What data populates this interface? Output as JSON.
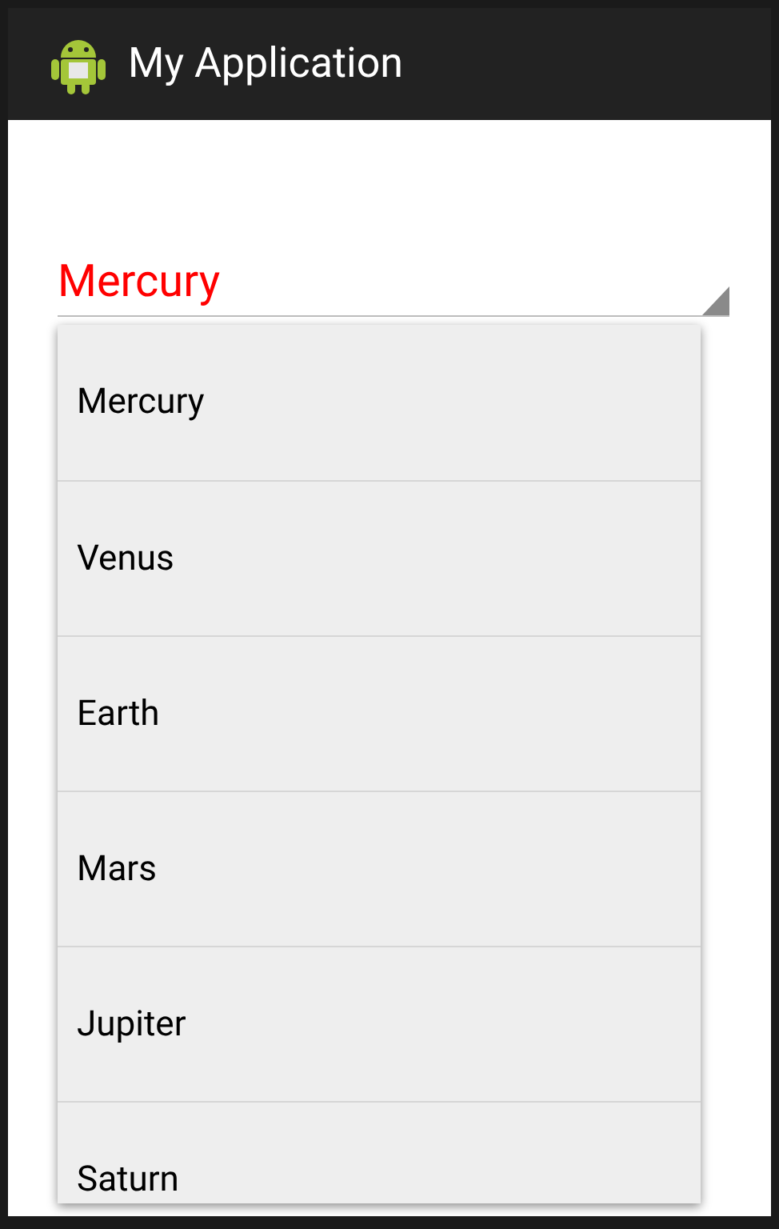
{
  "action_bar": {
    "title": "My Application"
  },
  "spinner": {
    "value": "Mercury"
  },
  "dropdown": {
    "items": [
      {
        "label": "Mercury"
      },
      {
        "label": "Venus"
      },
      {
        "label": "Earth"
      },
      {
        "label": "Mars"
      },
      {
        "label": "Jupiter"
      },
      {
        "label": "Saturn"
      }
    ]
  }
}
